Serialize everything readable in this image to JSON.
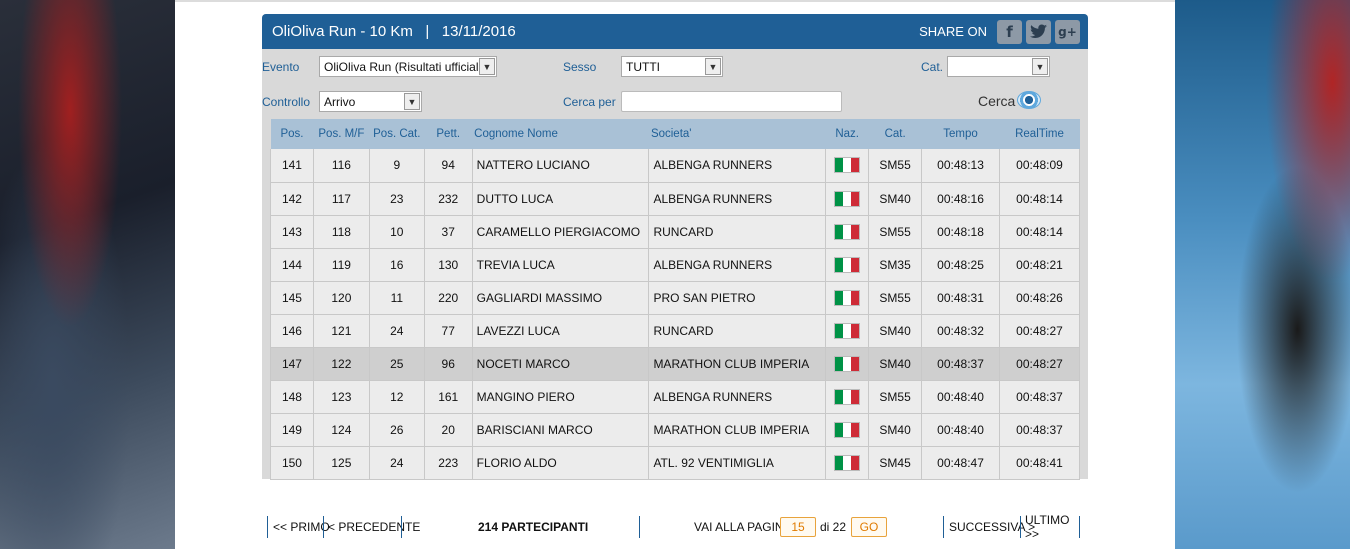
{
  "event": {
    "title": "OliOliva Run - 10 Km",
    "date": "13/11/2016",
    "share_label": "SHARE ON",
    "social": [
      {
        "name": "facebook-icon",
        "glyph": "f"
      },
      {
        "name": "twitter-icon",
        "glyph": "t"
      },
      {
        "name": "googleplus-icon",
        "glyph": "g+"
      }
    ]
  },
  "filters": {
    "evento_label": "Evento",
    "evento_value": "OliOliva Run (Risultati ufficiali)",
    "sesso_label": "Sesso",
    "sesso_value": "TUTTI",
    "cat_label": "Cat.",
    "cat_value": "",
    "controllo_label": "Controllo",
    "controllo_value": "Arrivo",
    "cerca_per_label": "Cerca per",
    "cerca_per_value": "",
    "cerca_label": "Cerca"
  },
  "table": {
    "headers": [
      "Pos.",
      "Pos. M/F",
      "Pos. Cat.",
      "Pett.",
      "Cognome Nome",
      "Societa'",
      "Naz.",
      "Cat.",
      "Tempo",
      "RealTime"
    ],
    "rows": [
      {
        "pos": "141",
        "pos_mf": "116",
        "pos_cat": "9",
        "pett": "94",
        "name": "NATTERO LUCIANO",
        "club": "ALBENGA RUNNERS",
        "cat": "SM55",
        "tempo": "00:48:13",
        "realtime": "00:48:09"
      },
      {
        "pos": "142",
        "pos_mf": "117",
        "pos_cat": "23",
        "pett": "232",
        "name": "DUTTO LUCA",
        "club": "ALBENGA RUNNERS",
        "cat": "SM40",
        "tempo": "00:48:16",
        "realtime": "00:48:14"
      },
      {
        "pos": "143",
        "pos_mf": "118",
        "pos_cat": "10",
        "pett": "37",
        "name": "CARAMELLO PIERGIACOMO",
        "club": "RUNCARD",
        "cat": "SM55",
        "tempo": "00:48:18",
        "realtime": "00:48:14"
      },
      {
        "pos": "144",
        "pos_mf": "119",
        "pos_cat": "16",
        "pett": "130",
        "name": "TREVIA LUCA",
        "club": "ALBENGA RUNNERS",
        "cat": "SM35",
        "tempo": "00:48:25",
        "realtime": "00:48:21"
      },
      {
        "pos": "145",
        "pos_mf": "120",
        "pos_cat": "11",
        "pett": "220",
        "name": "GAGLIARDI MASSIMO",
        "club": "PRO SAN PIETRO",
        "cat": "SM55",
        "tempo": "00:48:31",
        "realtime": "00:48:26"
      },
      {
        "pos": "146",
        "pos_mf": "121",
        "pos_cat": "24",
        "pett": "77",
        "name": "LAVEZZI LUCA",
        "club": "RUNCARD",
        "cat": "SM40",
        "tempo": "00:48:32",
        "realtime": "00:48:27"
      },
      {
        "pos": "147",
        "pos_mf": "122",
        "pos_cat": "25",
        "pett": "96",
        "name": "NOCETI MARCO",
        "club": "MARATHON CLUB IMPERIA",
        "cat": "SM40",
        "tempo": "00:48:37",
        "realtime": "00:48:27"
      },
      {
        "pos": "148",
        "pos_mf": "123",
        "pos_cat": "12",
        "pett": "161",
        "name": "MANGINO PIERO",
        "club": "ALBENGA RUNNERS",
        "cat": "SM55",
        "tempo": "00:48:40",
        "realtime": "00:48:37"
      },
      {
        "pos": "149",
        "pos_mf": "124",
        "pos_cat": "26",
        "pett": "20",
        "name": "BARISCIANI MARCO",
        "club": "MARATHON CLUB IMPERIA",
        "cat": "SM40",
        "tempo": "00:48:40",
        "realtime": "00:48:37"
      },
      {
        "pos": "150",
        "pos_mf": "125",
        "pos_cat": "24",
        "pett": "223",
        "name": "FLORIO ALDO",
        "club": "ATL. 92 VENTIMIGLIA",
        "cat": "SM45",
        "tempo": "00:48:47",
        "realtime": "00:48:41"
      }
    ],
    "highlighted_row": 6,
    "flag_colors": [
      "#009246",
      "#ffffff",
      "#ce2b37"
    ]
  },
  "pager": {
    "first": "<< PRIMO",
    "prev": "< PRECEDENTE",
    "participants": "214 PARTECIPANTI",
    "goto_label": "VAI ALLA PAGINA",
    "page": "15",
    "of_label": "di 22",
    "go": "GO",
    "next": "SUCCESSIVA >",
    "last": "ULTIMO >>"
  },
  "colors": {
    "accent": "#1f5f96",
    "header_row": "#a9c1d6",
    "pager_highlight": "#e07b00"
  }
}
